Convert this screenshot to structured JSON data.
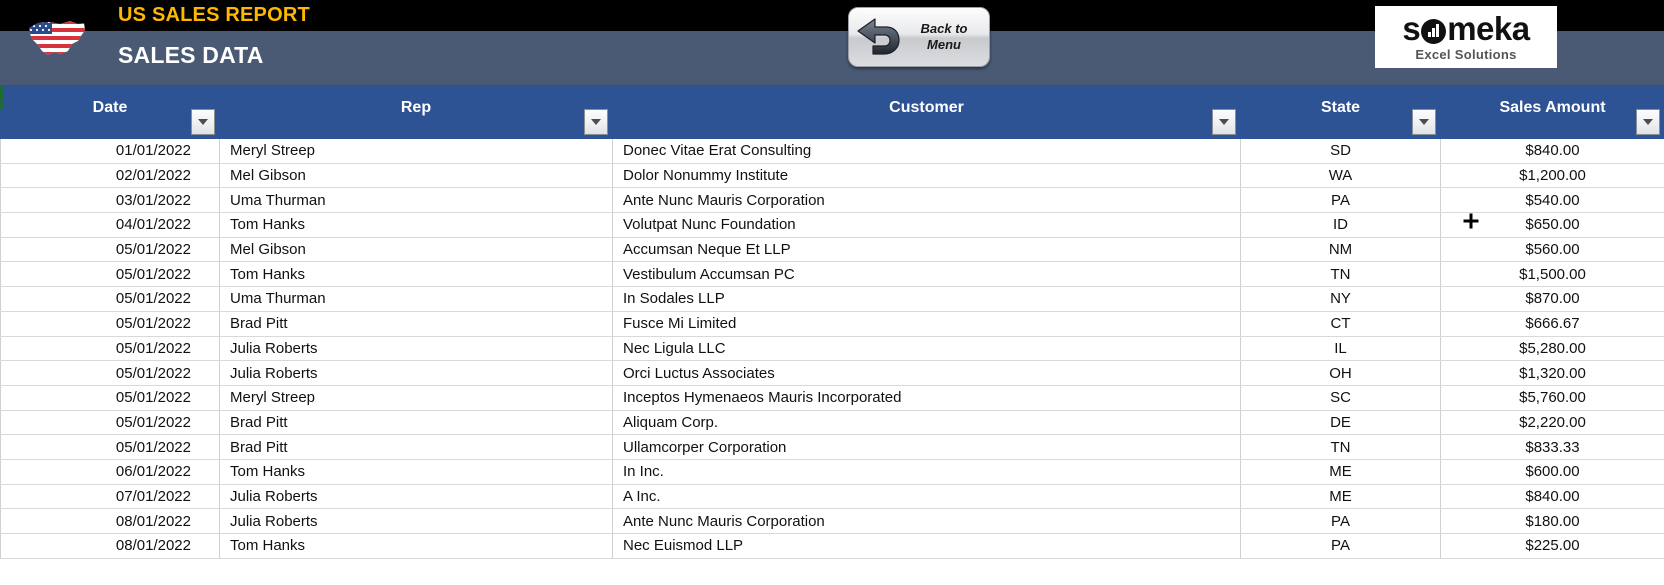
{
  "header": {
    "report_title": "US SALES REPORT",
    "sheet_title": "SALES DATA",
    "flag_icon": "us-flag-map-icon",
    "back_button": {
      "line1": "Back to",
      "line2": "Menu",
      "icon": "back-arrow-icon"
    },
    "logo": {
      "word_part1": "s",
      "o_mark": "chart-in-circle-icon",
      "word_part2": "meka",
      "subtitle": "Excel Solutions"
    },
    "colors": {
      "banner_black": "#000000",
      "banner_slate": "#4a5a75",
      "title_gold": "#FFB800",
      "table_header_blue": "#2e5395"
    }
  },
  "table": {
    "filter_icon": "filter-dropdown-caret-icon",
    "columns": [
      {
        "key": "date",
        "label": "Date"
      },
      {
        "key": "rep",
        "label": "Rep"
      },
      {
        "key": "cust",
        "label": "Customer"
      },
      {
        "key": "state",
        "label": "State"
      },
      {
        "key": "amt",
        "label": "Sales Amount"
      }
    ],
    "rows": [
      {
        "date": "01/01/2022",
        "rep": "Meryl Streep",
        "cust": "Donec Vitae Erat Consulting",
        "state": "SD",
        "amt": "$840.00"
      },
      {
        "date": "02/01/2022",
        "rep": "Mel Gibson",
        "cust": "Dolor Nonummy Institute",
        "state": "WA",
        "amt": "$1,200.00"
      },
      {
        "date": "03/01/2022",
        "rep": "Uma Thurman",
        "cust": "Ante Nunc Mauris Corporation",
        "state": "PA",
        "amt": "$540.00"
      },
      {
        "date": "04/01/2022",
        "rep": "Tom Hanks",
        "cust": "Volutpat Nunc Foundation",
        "state": "ID",
        "amt": "$650.00"
      },
      {
        "date": "05/01/2022",
        "rep": "Mel Gibson",
        "cust": "Accumsan Neque Et LLP",
        "state": "NM",
        "amt": "$560.00"
      },
      {
        "date": "05/01/2022",
        "rep": "Tom Hanks",
        "cust": "Vestibulum Accumsan PC",
        "state": "TN",
        "amt": "$1,500.00"
      },
      {
        "date": "05/01/2022",
        "rep": "Uma Thurman",
        "cust": "In Sodales LLP",
        "state": "NY",
        "amt": "$870.00"
      },
      {
        "date": "05/01/2022",
        "rep": "Brad Pitt",
        "cust": "Fusce Mi Limited",
        "state": "CT",
        "amt": "$666.67"
      },
      {
        "date": "05/01/2022",
        "rep": "Julia Roberts",
        "cust": "Nec Ligula LLC",
        "state": "IL",
        "amt": "$5,280.00"
      },
      {
        "date": "05/01/2022",
        "rep": "Julia Roberts",
        "cust": "Orci Luctus Associates",
        "state": "OH",
        "amt": "$1,320.00"
      },
      {
        "date": "05/01/2022",
        "rep": "Meryl Streep",
        "cust": "Inceptos Hymenaeos Mauris Incorporated",
        "state": "SC",
        "amt": "$5,760.00"
      },
      {
        "date": "05/01/2022",
        "rep": "Brad Pitt",
        "cust": "Aliquam Corp.",
        "state": "DE",
        "amt": "$2,220.00"
      },
      {
        "date": "05/01/2022",
        "rep": "Brad Pitt",
        "cust": "Ullamcorper Corporation",
        "state": "TN",
        "amt": "$833.33"
      },
      {
        "date": "06/01/2022",
        "rep": "Tom Hanks",
        "cust": "In Inc.",
        "state": "ME",
        "amt": "$600.00"
      },
      {
        "date": "07/01/2022",
        "rep": "Julia Roberts",
        "cust": "A Inc.",
        "state": "ME",
        "amt": "$840.00"
      },
      {
        "date": "08/01/2022",
        "rep": "Julia Roberts",
        "cust": "Ante Nunc Mauris Corporation",
        "state": "PA",
        "amt": "$180.00"
      },
      {
        "date": "08/01/2022",
        "rep": "Tom Hanks",
        "cust": "Nec Euismod LLP",
        "state": "PA",
        "amt": "$225.00"
      }
    ]
  }
}
